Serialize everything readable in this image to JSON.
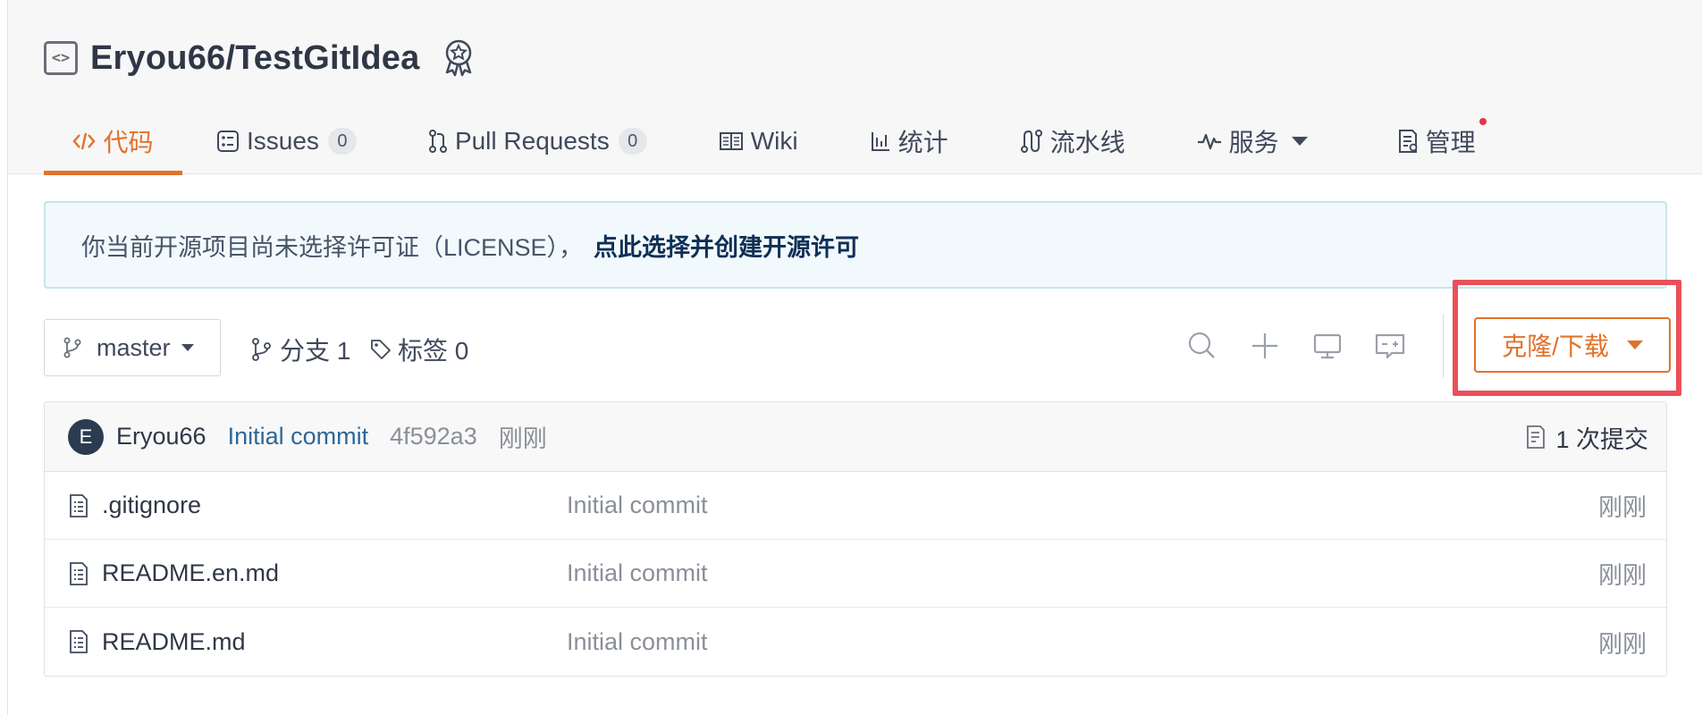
{
  "repo": {
    "title": "Eryou66/TestGitIdea",
    "repo_icon": "code-brackets-icon",
    "award_icon": "award-badge-icon"
  },
  "tabs": [
    {
      "label": "代码",
      "icon": "code-icon",
      "active": true
    },
    {
      "label": "Issues",
      "icon": "issues-icon",
      "badge": "0"
    },
    {
      "label": "Pull Requests",
      "icon": "pull-request-icon",
      "badge": "0"
    },
    {
      "label": "Wiki",
      "icon": "wiki-book-icon"
    },
    {
      "label": "统计",
      "icon": "bar-chart-icon"
    },
    {
      "label": "流水线",
      "icon": "pipeline-icon"
    },
    {
      "label": "服务",
      "icon": "pulse-icon",
      "dropdown": true
    },
    {
      "label": "管理",
      "icon": "manage-doc-icon",
      "notification_dot": true
    }
  ],
  "license_notice": {
    "text": "你当前开源项目尚未选择许可证（LICENSE），",
    "link": "点此选择并创建开源许可"
  },
  "toolbar": {
    "branch": "master",
    "branches_label": "分支 1",
    "tags_label": "标签 0",
    "clone_button": "克隆/下载"
  },
  "commit": {
    "avatar_letter": "E",
    "author": "Eryou66",
    "message": "Initial commit",
    "hash": "4f592a3",
    "time": "刚刚",
    "count_label": "1 次提交"
  },
  "files": [
    {
      "name": ".gitignore",
      "message": "Initial commit",
      "time": "刚刚"
    },
    {
      "name": "README.en.md",
      "message": "Initial commit",
      "time": "刚刚"
    },
    {
      "name": "README.md",
      "message": "Initial commit",
      "time": "刚刚"
    }
  ],
  "colors": {
    "accent": "#e2712a",
    "highlight": "#e9505a",
    "link": "#2f6795",
    "notice_bg": "#f2f9fc"
  }
}
